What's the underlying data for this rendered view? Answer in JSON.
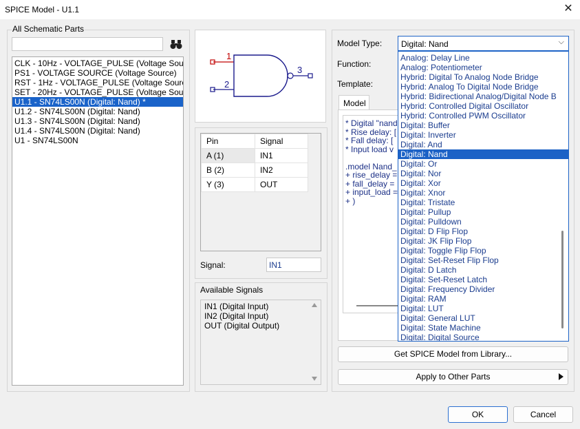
{
  "window": {
    "title": "SPICE Model - U1.1"
  },
  "parts": {
    "label": "All Schematic Parts",
    "search_value": "",
    "items": [
      "CLK - 10Hz - VOLTAGE_PULSE (Voltage Sou",
      "PS1 - VOLTAGE SOURCE (Voltage Source)",
      "RST - 1Hz - VOLTAGE_PULSE (Voltage Sourc",
      "SET - 20Hz - VOLTAGE_PULSE (Voltage Sou",
      "U1.1 - SN74LS00N (Digital: Nand) *",
      "U1.2 - SN74LS00N (Digital: Nand)",
      "U1.3 - SN74LS00N (Digital: Nand)",
      "U1.4 - SN74LS00N (Digital: Nand)",
      "U1 - SN74LS00N"
    ],
    "selected_index": 4
  },
  "symbol": {
    "pin1": "1",
    "pin2": "2",
    "pin3": "3"
  },
  "pin_table": {
    "headers": [
      "Pin",
      "Signal"
    ],
    "rows": [
      [
        "A (1)",
        "IN1"
      ],
      [
        "B (2)",
        "IN2"
      ],
      [
        "Y (3)",
        "OUT"
      ]
    ]
  },
  "signal": {
    "label": "Signal:",
    "value": "IN1"
  },
  "available_signals": {
    "label": "Available Signals",
    "items": [
      "IN1 (Digital Input)",
      "IN2 (Digital Input)",
      "OUT (Digital Output)"
    ]
  },
  "model": {
    "type_label": "Model Type:",
    "type_value": "Digital: Nand",
    "function_label": "Function:",
    "template_label": "Template:",
    "tab_label": "Model",
    "code_lines": [
      "* Digital \"nand",
      "* Rise delay: [",
      "* Fall delay: [",
      "* Input load v",
      "",
      ".model Nand_",
      "+ rise_delay =",
      "+ fall_delay =",
      "+ input_load =",
      "+ )"
    ]
  },
  "dropdown": {
    "items": [
      "Analog: Delay Line",
      "Analog: Potentiometer",
      "Hybrid: Digital To Analog Node Bridge",
      "Hybrid: Analog To Digital Node Bridge",
      "Hybrid: Bidirectional Analog/Digital Node B",
      "Hybrid: Controlled Digital Oscillator",
      "Hybrid: Controlled PWM Oscillator",
      "Digital: Buffer",
      "Digital: Inverter",
      "Digital: And",
      "Digital: Nand",
      "Digital: Or",
      "Digital: Nor",
      "Digital: Xor",
      "Digital: Xnor",
      "Digital: Tristate",
      "Digital: Pullup",
      "Digital: Pulldown",
      "Digital: D Flip Flop",
      "Digital: JK Flip Flop",
      "Digital: Toggle Flip Flop",
      "Digital: Set-Reset Flip Flop",
      "Digital: D Latch",
      "Digital: Set-Reset Latch",
      "Digital: Frequency Divider",
      "Digital: RAM",
      "Digital: LUT",
      "Digital: General LUT",
      "Digital: State Machine",
      "Digital: Digital Source"
    ],
    "selected_index": 10
  },
  "buttons": {
    "get_model": "Get SPICE Model from Library...",
    "apply_other": "Apply to Other Parts",
    "ok": "OK",
    "cancel": "Cancel"
  },
  "colors": {
    "accent": "#1c62c6",
    "schematic_blue": "#1a1a8c",
    "pin_red": "#c00000"
  }
}
